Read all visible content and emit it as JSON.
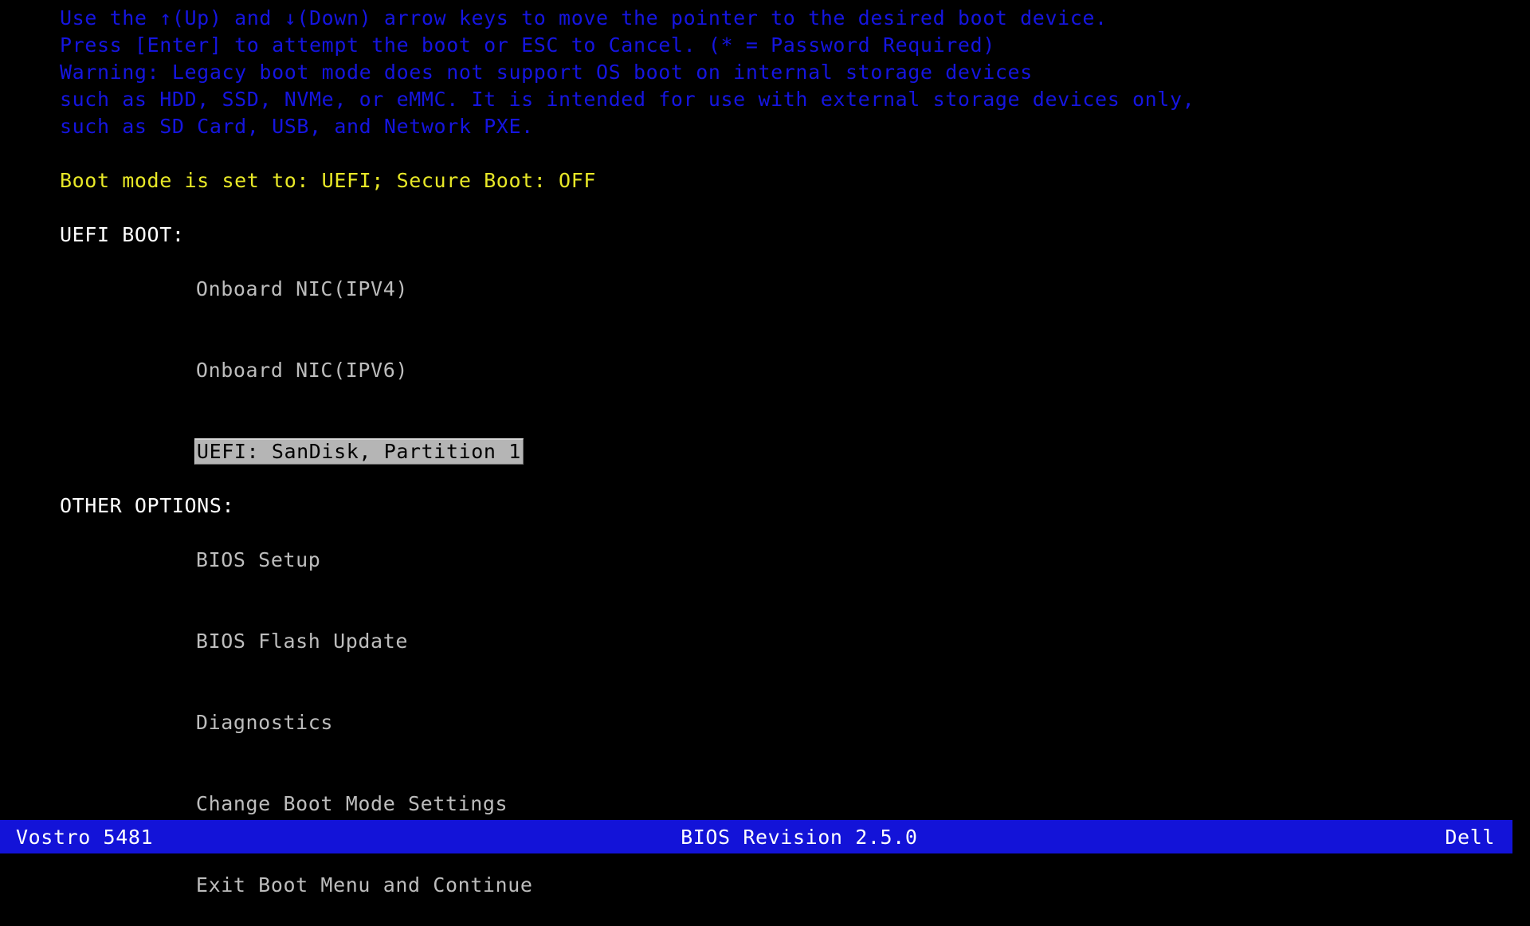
{
  "instructions": {
    "line1": "Use the ↑(Up) and ↓(Down) arrow keys to move the pointer to the desired boot device.",
    "line2": "Press [Enter] to attempt the boot or ESC to Cancel. (* = Password Required)",
    "line3": "Warning: Legacy boot mode does not support OS boot on internal storage devices",
    "line4": "such as HDD, SSD, NVMe, or eMMC. It is intended for use with external storage devices only,",
    "line5": "such as SD Card, USB, and Network PXE."
  },
  "boot_mode_status": "Boot mode is set to: UEFI; Secure Boot: OFF",
  "sections": {
    "uefi_boot": {
      "header": "UEFI BOOT:",
      "items": [
        {
          "label": "Onboard NIC(IPV4)",
          "selected": false
        },
        {
          "label": "Onboard NIC(IPV6)",
          "selected": false
        },
        {
          "label": "UEFI: SanDisk, Partition 1",
          "selected": true
        }
      ]
    },
    "other_options": {
      "header": "OTHER OPTIONS:",
      "items": [
        {
          "label": "BIOS Setup",
          "selected": false
        },
        {
          "label": "BIOS Flash Update",
          "selected": false
        },
        {
          "label": "Diagnostics",
          "selected": false
        },
        {
          "label": "Change Boot Mode Settings",
          "selected": false
        },
        {
          "label": "Exit Boot Menu and Continue",
          "selected": false
        }
      ]
    }
  },
  "status_bar": {
    "model": "Vostro 5481",
    "bios_revision": "BIOS Revision 2.5.0",
    "vendor": "Dell"
  },
  "colors": {
    "background": "#000000",
    "instruction_text": "#1515e0",
    "boot_mode_text": "#e8e827",
    "section_header_text": "#ffffff",
    "menu_item_text": "#bdbdbd",
    "highlight_background": "#b5b5b5",
    "highlight_text": "#000000",
    "status_bar_background": "#1313d8",
    "status_bar_text": "#ffffff"
  }
}
